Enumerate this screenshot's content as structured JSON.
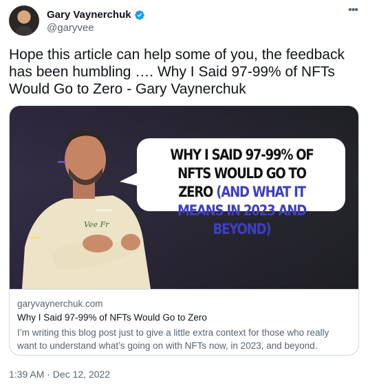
{
  "author": {
    "display_name": "Gary Vaynerchuk",
    "handle": "@garyvee"
  },
  "tweet": {
    "text": "Hope this article can help some of you, the feedback has been humbling …. Why I Said 97-99% of NFTs Would Go to Zero - Gary Vaynerchuk",
    "timestamp": "1:39 AM · Dec 12, 2022"
  },
  "card": {
    "image_headline_black": "WHY I SAID 97-99% OF NFTS WOULD GO TO ZERO",
    "image_headline_blue": "(AND WHAT IT MEANS IN 2023 AND BEYOND)",
    "shirt_text": "Vee Fr",
    "domain": "garyvaynerchuk.com",
    "title": "Why I Said 97-99% of NFTs Would Go to Zero",
    "description": "I’m writing this blog post just to give a little extra context for those who really want to understand what’s going on with NFTs now, in 2023, and beyond."
  },
  "colors": {
    "verified": "#1d9bf0",
    "secondary_text": "#536471",
    "headline_blue": "#3d3fbf"
  },
  "icons": {
    "verified": "verified-badge-icon",
    "more": "more-options-icon"
  }
}
